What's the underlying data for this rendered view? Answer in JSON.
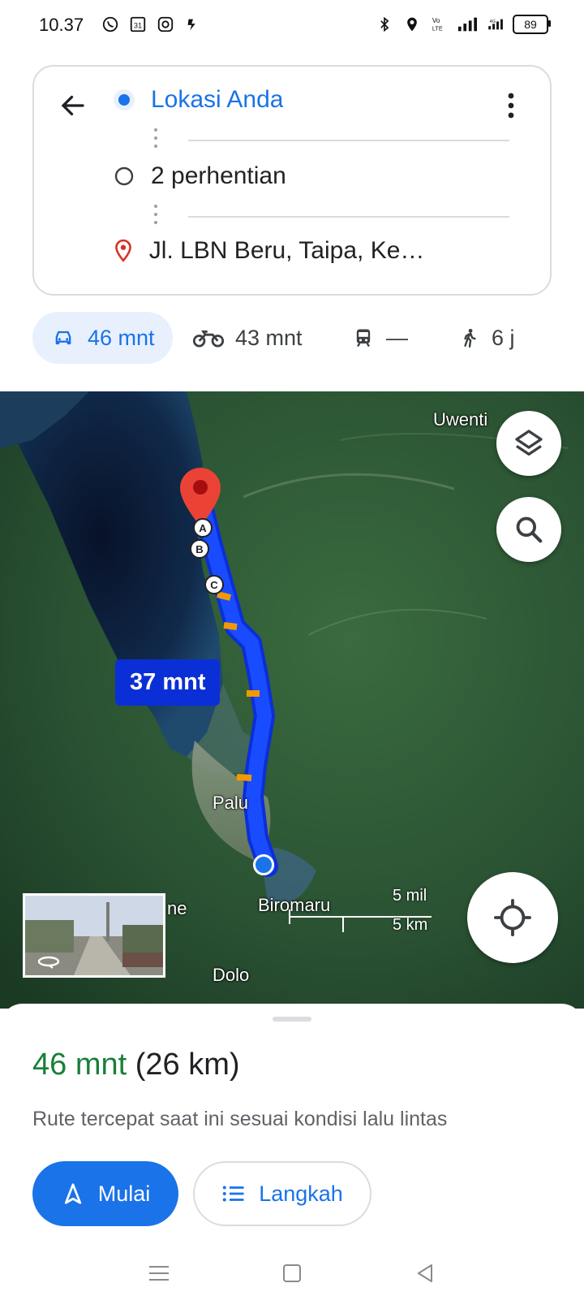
{
  "status_bar": {
    "time": "10.37",
    "calendar_day": "31",
    "network": "4G",
    "battery": "89"
  },
  "route": {
    "origin": "Lokasi Anda",
    "stops": "2 perhentian",
    "destination": "Jl. LBN Beru, Taipa, Kec. P..."
  },
  "modes": [
    {
      "name": "car",
      "label": "46 mnt",
      "active": true
    },
    {
      "name": "motorcycle",
      "label": "43 mnt",
      "active": false
    },
    {
      "name": "transit",
      "label": "—",
      "active": false
    },
    {
      "name": "walk",
      "label": "6 j",
      "active": false
    }
  ],
  "map": {
    "eta_badge": "37 mnt",
    "labels": {
      "uwenti": "Uwenti",
      "palu": "Palu",
      "biromaru": "Biromaru",
      "dolo": "Dolo",
      "ne": "ne"
    },
    "waypoints": [
      "A",
      "B",
      "C"
    ],
    "scale_mi": "5 mil",
    "scale_km": "5 km"
  },
  "sheet": {
    "duration": "46 mnt",
    "distance": "(26 km)",
    "description": "Rute tercepat saat ini sesuai kondisi lalu lintas",
    "start_label": "Mulai",
    "steps_label": "Langkah"
  },
  "colors": {
    "accent": "#1a73e8",
    "route": "#1a4cff",
    "duration": "#188038"
  }
}
